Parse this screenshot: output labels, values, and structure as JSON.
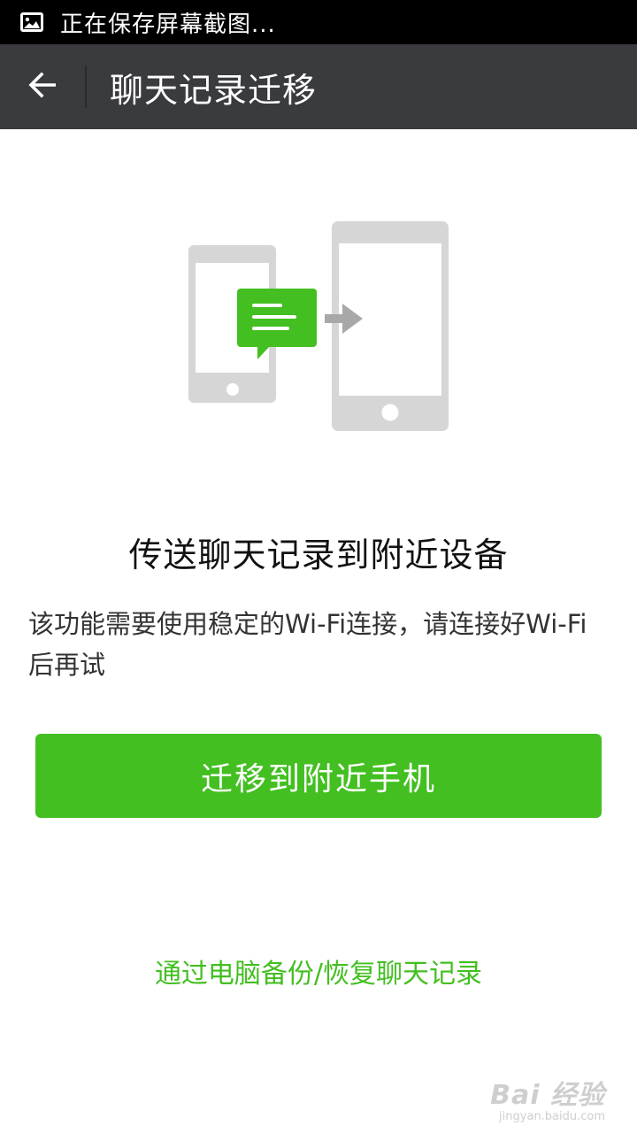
{
  "status_bar": {
    "icon": "picture-icon",
    "text": "正在保存屏幕截图..."
  },
  "action_bar": {
    "back_icon": "back-arrow-icon",
    "title": "聊天记录迁移"
  },
  "illustration": {
    "icon": "phone-transfer-illustration",
    "colors": {
      "phone": "#d6d6d6",
      "screen": "#ffffff",
      "chat_bubble": "#43bf21",
      "arrow": "#a8a8a8"
    }
  },
  "main": {
    "heading": "传送聊天记录到附近设备",
    "description": "该功能需要使用稳定的Wi-Fi连接，请连接好Wi-Fi后再试",
    "primary_button": "迁移到附近手机",
    "pc_link": "通过电脑备份/恢复聊天记录"
  },
  "watermark": {
    "main": "Bai 经验",
    "sub": "jingyan.baidu.com"
  },
  "colors": {
    "accent": "#43bf21",
    "action_bar": "#3a3b3f",
    "status_bar": "#000000"
  }
}
